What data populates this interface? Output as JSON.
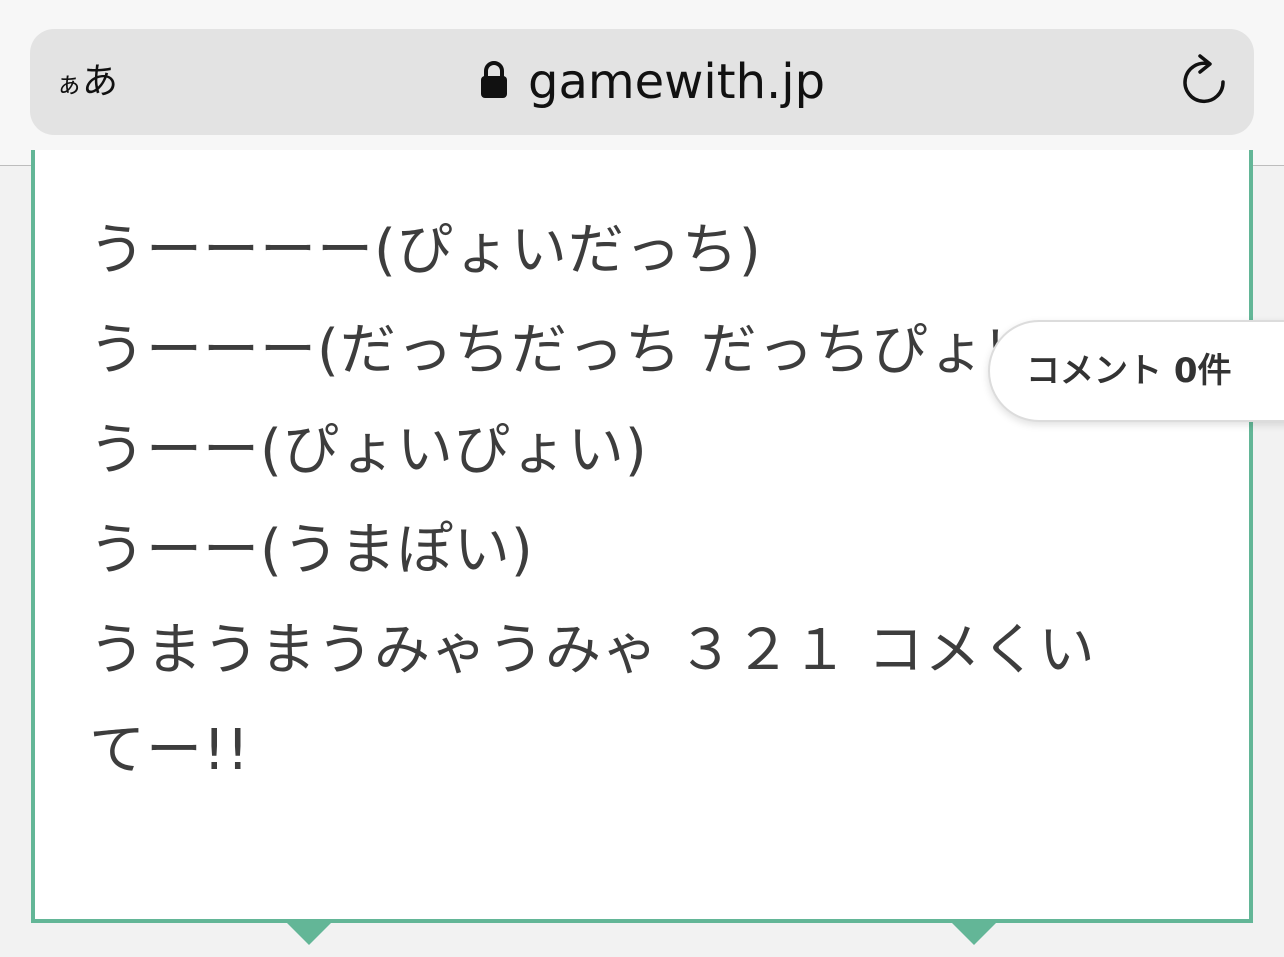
{
  "browser": {
    "text_size_label_small": "ぁ",
    "text_size_label_large": "あ",
    "url": "gamewith.jp"
  },
  "content": {
    "lines": [
      "うーーーー(ぴょいだっち)",
      "うーーー(だっちだっち だっちぴょい)",
      "うーー(ぴょいぴょい)",
      "うーー(うまぽい)",
      "うまうまうみゃうみゃ ３２１ コメくい",
      "てー!!"
    ]
  },
  "comment_tab": {
    "label": "コメント 0件"
  },
  "colors": {
    "accent": "#63b697",
    "text": "#3d3d3d",
    "url_bar": "#e3e3e3"
  },
  "icons": {
    "lock": "lock-icon",
    "reload": "reload-icon"
  }
}
